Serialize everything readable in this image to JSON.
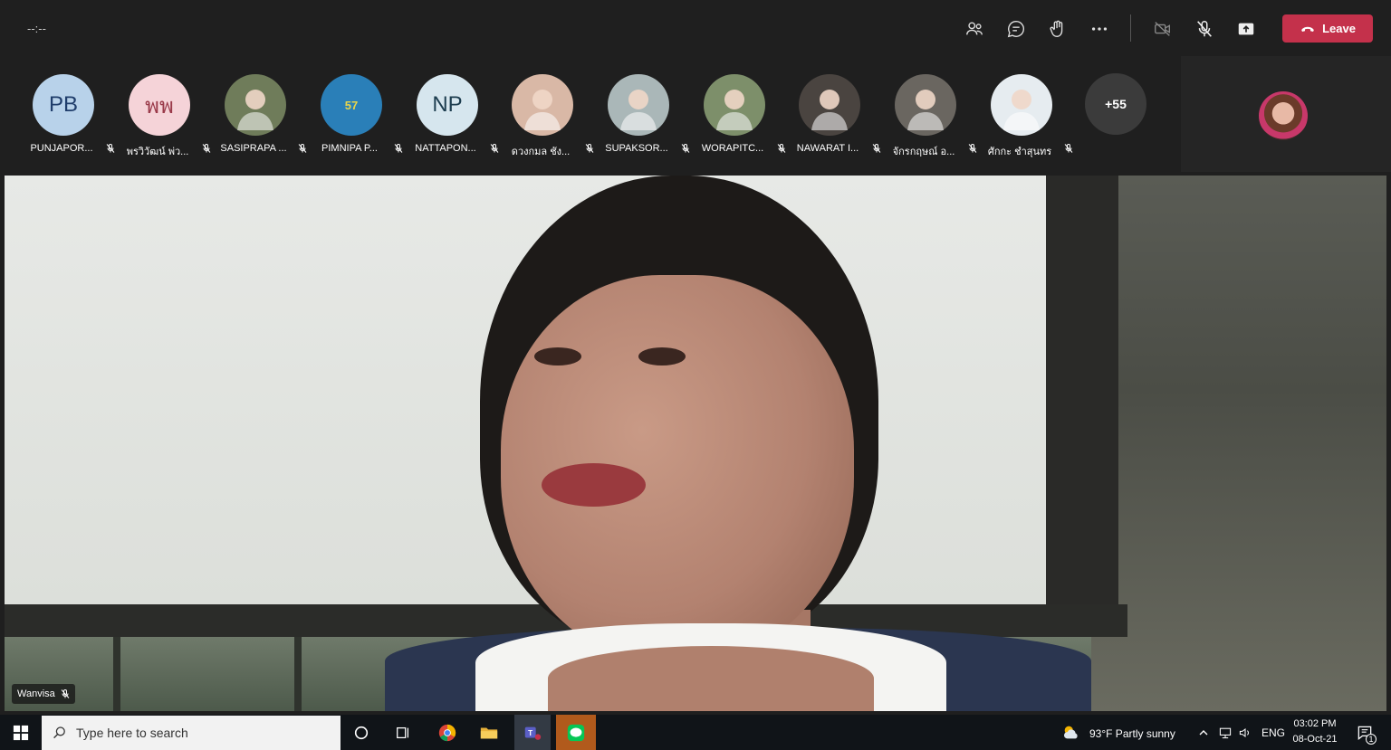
{
  "call": {
    "timer": "--:--",
    "leave_label": "Leave",
    "colors": {
      "leave": "#c4314b",
      "bar": "#1f1f1f"
    }
  },
  "participants": [
    {
      "initials": "PB",
      "name": "PUNJAPOR...",
      "avatar_bg": "#b8d2ea",
      "avatar_fg": "#1f3d6b",
      "icon": "initials"
    },
    {
      "initials": "พพ",
      "name": "พรวิวัฒน์ พ่ว...",
      "avatar_bg": "#f5d3d8",
      "avatar_fg": "#9a3a4a",
      "icon": "initials"
    },
    {
      "initials": "",
      "name": "SASIPRAPA ...",
      "avatar_bg": "#6f7c5a",
      "icon": "photo"
    },
    {
      "initials": "57",
      "name": "PIMNIPA P...",
      "avatar_bg": "#2a7fb8",
      "avatar_fg": "#e8d44a",
      "icon": "initials"
    },
    {
      "initials": "NP",
      "name": "NATTAPON...",
      "avatar_bg": "#d6e6ee",
      "avatar_fg": "#1d3d4f",
      "icon": "initials"
    },
    {
      "initials": "",
      "name": "ดวงกมล ชัง...",
      "avatar_bg": "#d9b8a6",
      "icon": "photo"
    },
    {
      "initials": "",
      "name": "SUPAKSOR...",
      "avatar_bg": "#aab7b8",
      "icon": "photo"
    },
    {
      "initials": "",
      "name": "WORAPITC...",
      "avatar_bg": "#7d8f6a",
      "icon": "photo"
    },
    {
      "initials": "",
      "name": "NAWARAT I...",
      "avatar_bg": "#4a4440",
      "icon": "photo"
    },
    {
      "initials": "",
      "name": "จักรกฤษณ์ อ...",
      "avatar_bg": "#6a6660",
      "icon": "photo"
    },
    {
      "initials": "",
      "name": "ศักกะ ชำสุนทร",
      "avatar_bg": "#e6ecf0",
      "icon": "photo"
    }
  ],
  "more_count": "+55",
  "speaker": {
    "name": "Wanvisa"
  },
  "taskbar": {
    "search_placeholder": "Type here to search",
    "weather": "93°F  Partly sunny",
    "lang": "ENG",
    "time": "03:02 PM",
    "date": "08-Oct-21",
    "notifications": "1"
  }
}
